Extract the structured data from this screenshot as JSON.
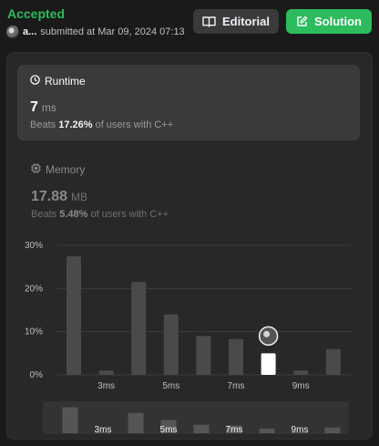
{
  "header": {
    "status": "Accepted",
    "user_name": "a...",
    "submitted_text": "submitted at Mar 09, 2024 07:13",
    "editorial_label": "Editorial",
    "solution_label": "Solution"
  },
  "runtime": {
    "label": "Runtime",
    "value": "7",
    "unit": "ms",
    "beats_prefix": "Beats",
    "beats_percent": "17.26%",
    "beats_suffix": "of users with C++"
  },
  "memory": {
    "label": "Memory",
    "value": "17.88",
    "unit": "MB",
    "beats_prefix": "Beats",
    "beats_percent": "5.48%",
    "beats_suffix": "of users with C++"
  },
  "colors": {
    "accepted": "#2cbb5d",
    "bar": "#4a4a4a",
    "highlight_bar": "#ffffff"
  },
  "chart_data": {
    "type": "bar",
    "y_tick_labels": [
      "30%",
      "20%",
      "10%",
      "0%"
    ],
    "ylim": [
      0,
      30
    ],
    "x_tick_labels": [
      "3ms",
      "5ms",
      "7ms",
      "9ms"
    ],
    "x": [
      2,
      3,
      4,
      5,
      6,
      7,
      8,
      9,
      10
    ],
    "values": [
      27.5,
      1,
      21.5,
      14,
      9,
      8.3,
      5,
      1,
      6
    ],
    "highlight_x": 8,
    "grid": true
  }
}
